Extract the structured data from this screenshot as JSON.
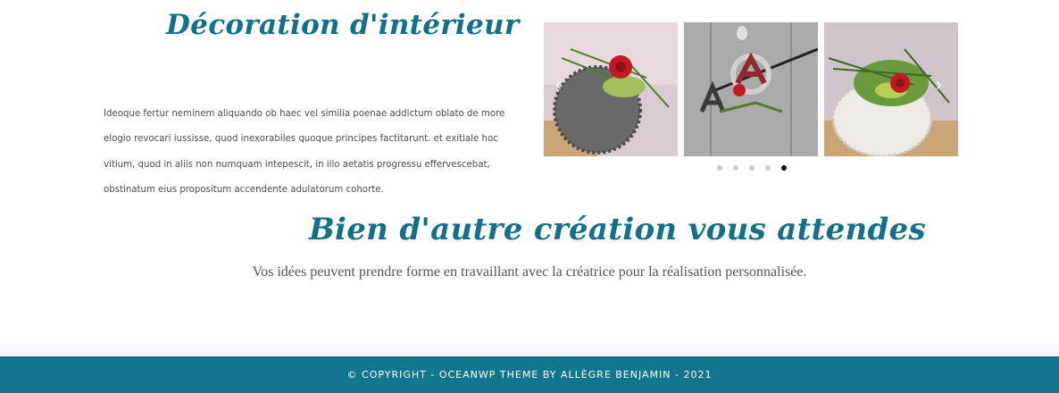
{
  "section1": {
    "title": "Décoration d'intérieur",
    "text": "Ideoque fertur neminem aliquando ob haec vel similia poenae addictum oblato de more elogio revocari iussisse, quod inexorabiles quoque principes factitarunt. et exitiale hoc vitium, quod in aliis non numquam intepescit, in illo aetatis progressu effervescebat, obstinatum eius propositum accendente adulatorum cohorte."
  },
  "carousel": {
    "prev_icon": "chevron-left-icon",
    "next_icon": "chevron-right-icon",
    "prev_glyph": "‹",
    "next_glyph": "›",
    "slides": [
      {
        "name": "photo-rose-grey-sphere"
      },
      {
        "name": "photo-letters-door-decoration"
      },
      {
        "name": "photo-rose-white-sphere"
      }
    ],
    "dot_count": 5,
    "active_dot": 5
  },
  "section2": {
    "title": "Bien d'autre création vous attendes",
    "tagline": "Vos idées peuvent prendre forme en travaillant avec la créatrice pour la réalisation personnalisée."
  },
  "footer": {
    "copyright": "© Copyright - OceanWP Theme by Allègre Benjamin - 2021"
  },
  "colors": {
    "accent": "#13708a",
    "footer_bg": "#13768f"
  }
}
